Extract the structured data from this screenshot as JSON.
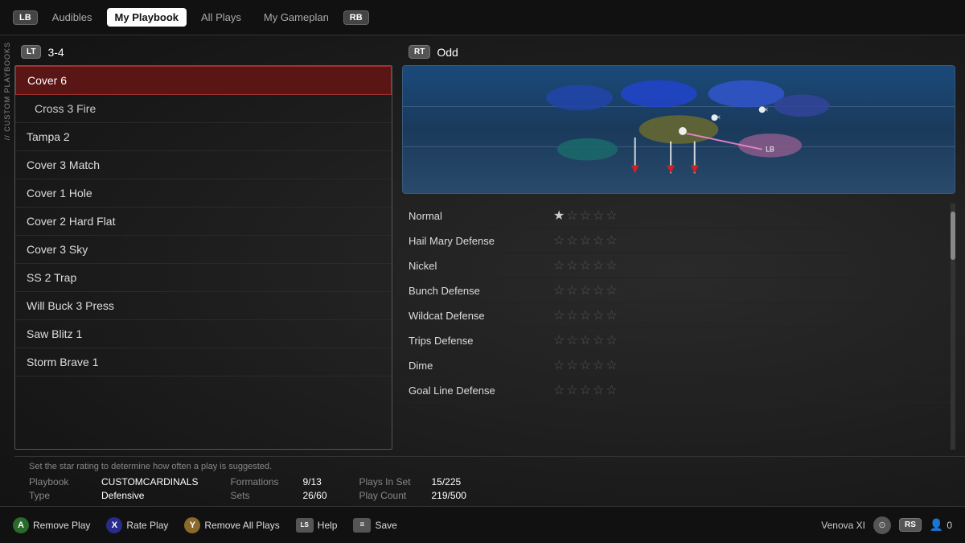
{
  "nav": {
    "lb_label": "LB",
    "rb_label": "RB",
    "tabs": [
      {
        "label": "Audibles",
        "active": false
      },
      {
        "label": "My Playbook",
        "active": true
      },
      {
        "label": "All Plays",
        "active": false
      },
      {
        "label": "My Gameplan",
        "active": false
      }
    ],
    "sidebar_label": "// CUSTOM PLAYBOOKS"
  },
  "left_panel": {
    "lt_label": "LT",
    "formation": "3-4",
    "plays": [
      {
        "label": "Cover 6",
        "selected": true,
        "sub": false
      },
      {
        "label": "Cross 3 Fire",
        "selected": false,
        "sub": true
      },
      {
        "label": "Tampa 2",
        "selected": false,
        "sub": false
      },
      {
        "label": "Cover 3 Match",
        "selected": false,
        "sub": false
      },
      {
        "label": "Cover 1 Hole",
        "selected": false,
        "sub": false
      },
      {
        "label": "Cover 2 Hard Flat",
        "selected": false,
        "sub": false
      },
      {
        "label": "Cover 3 Sky",
        "selected": false,
        "sub": false
      },
      {
        "label": "SS 2 Trap",
        "selected": false,
        "sub": false
      },
      {
        "label": "Will Buck 3 Press",
        "selected": false,
        "sub": false
      },
      {
        "label": "Saw Blitz 1",
        "selected": false,
        "sub": false
      },
      {
        "label": "Storm Brave 1",
        "selected": false,
        "sub": false
      }
    ]
  },
  "right_panel": {
    "rt_label": "RT",
    "formation_name": "Odd",
    "situations": [
      {
        "name": "Normal",
        "stars": 1
      },
      {
        "name": "Hail Mary Defense",
        "stars": 0
      },
      {
        "name": "Nickel",
        "stars": 0
      },
      {
        "name": "Bunch Defense",
        "stars": 0
      },
      {
        "name": "Wildcat Defense",
        "stars": 0
      },
      {
        "name": "Trips Defense",
        "stars": 0
      },
      {
        "name": "Dime",
        "stars": 0
      },
      {
        "name": "Goal Line Defense",
        "stars": 0
      }
    ]
  },
  "hint": "Set the star rating to determine how often a play is suggested.",
  "stats": {
    "playbook_label": "Playbook",
    "playbook_value": "CUSTOMCARDINALS",
    "formations_label": "Formations",
    "formations_value": "9/13",
    "plays_in_set_label": "Plays In Set",
    "plays_in_set_value": "15/225",
    "type_label": "Type",
    "type_value": "Defensive",
    "sets_label": "Sets",
    "sets_value": "26/60",
    "play_count_label": "Play Count",
    "play_count_value": "219/500"
  },
  "bottom_bar": {
    "actions": [
      {
        "badge": "A",
        "label": "Remove Play",
        "color": "btn-a"
      },
      {
        "badge": "X",
        "label": "Rate Play",
        "color": "btn-x"
      },
      {
        "badge": "Y",
        "label": "Remove All Plays",
        "color": "btn-y"
      },
      {
        "badge": "LS",
        "label": "Help",
        "color": "btn-ls"
      },
      {
        "badge": "≡",
        "label": "Save",
        "color": "btn-menu"
      }
    ],
    "user_name": "Venova XI",
    "player_count": "0"
  }
}
